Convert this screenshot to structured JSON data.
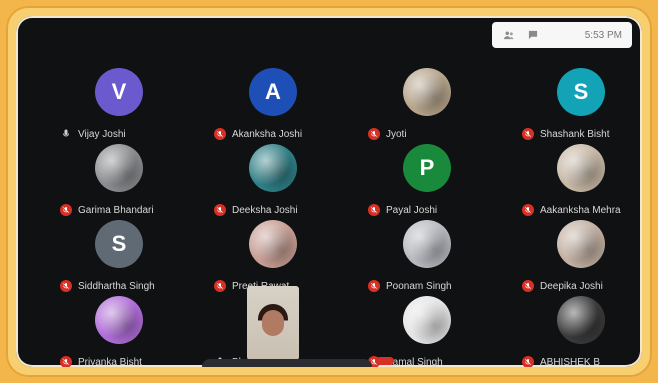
{
  "topbar": {
    "time": "5:53 PM",
    "icons": [
      "people-icon",
      "chat-icon"
    ]
  },
  "participants": [
    {
      "id": "p1",
      "label": "Vijay Joshi",
      "avatar": {
        "type": "letter",
        "letter": "V",
        "color": "#6a5acd"
      },
      "muted": false
    },
    {
      "id": "p2",
      "label": "Akanksha Joshi",
      "avatar": {
        "type": "letter",
        "letter": "A",
        "color": "#1e4fb6"
      },
      "muted": true
    },
    {
      "id": "p3",
      "label": "Jyoti",
      "avatar": {
        "type": "photo",
        "color": "#b6a48b"
      },
      "muted": true
    },
    {
      "id": "p4",
      "label": "Shashank Bisht",
      "avatar": {
        "type": "letter",
        "letter": "S",
        "color": "#13a3b6"
      },
      "muted": true
    },
    {
      "id": "p5",
      "label": "Garima Bhandari",
      "avatar": {
        "type": "photo",
        "color": "#8a8c8f"
      },
      "muted": true
    },
    {
      "id": "p6",
      "label": "Deeksha Joshi",
      "avatar": {
        "type": "photo",
        "color": "#2f7f86"
      },
      "muted": true
    },
    {
      "id": "p7",
      "label": "Payal Joshi",
      "avatar": {
        "type": "letter",
        "letter": "P",
        "color": "#198a3b"
      },
      "muted": true
    },
    {
      "id": "p8",
      "label": "Aakanksha Mehra",
      "avatar": {
        "type": "photo",
        "color": "#c7b8a5"
      },
      "muted": true
    },
    {
      "id": "p9",
      "label": "Siddhartha Singh",
      "avatar": {
        "type": "letter",
        "letter": "S",
        "color": "#5f6a75"
      },
      "muted": true
    },
    {
      "id": "p10",
      "label": "Preeti Rawat",
      "avatar": {
        "type": "photo",
        "color": "#c79d93"
      },
      "muted": true
    },
    {
      "id": "p11",
      "label": "Poonam Singh",
      "avatar": {
        "type": "photo",
        "color": "#b8b9bf"
      },
      "muted": true
    },
    {
      "id": "p12",
      "label": "Deepika Joshi",
      "avatar": {
        "type": "photo",
        "color": "#c2b0a2"
      },
      "muted": true
    },
    {
      "id": "p13",
      "label": "Priyanka Bisht",
      "avatar": {
        "type": "photo",
        "color": "#b06dd8"
      },
      "muted": true
    },
    {
      "id": "p14",
      "label": "Bhavna",
      "avatar": {
        "type": "video",
        "color": "#d7d1c6"
      },
      "muted": false
    },
    {
      "id": "p15",
      "label": "Kamal Singh",
      "avatar": {
        "type": "photo",
        "color": "#e4e4e4"
      },
      "muted": true
    },
    {
      "id": "p16",
      "label": "ABHISHEK B",
      "avatar": {
        "type": "photo",
        "color": "#3a3a3a"
      },
      "muted": true
    }
  ],
  "icons": {
    "mic_off": "mic-off-icon",
    "mic_on": "mic-icon"
  },
  "colors": {
    "frame_outer": "#f3b64a",
    "frame_inner": "#f7cf6e",
    "screen_bg": "#101113",
    "mute_red": "#d93025"
  }
}
